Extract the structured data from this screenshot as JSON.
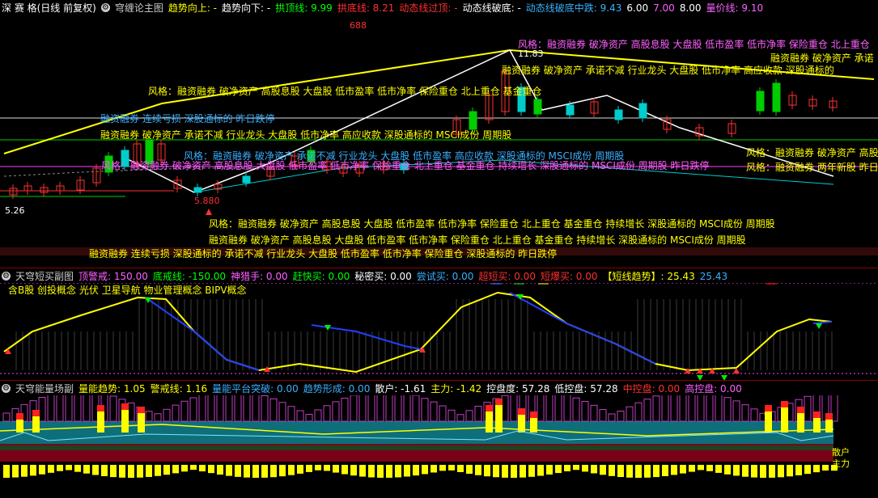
{
  "main": {
    "title": "深 赛 格(日线 前复权)",
    "indicator": "穹缠论主图",
    "items": [
      {
        "label": "趋势向上:",
        "value": "-",
        "color": "#ffff00"
      },
      {
        "label": "趋势向下:",
        "value": "-",
        "color": "#ffffff"
      },
      {
        "label": "拱顶线:",
        "value": "9.99",
        "color": "#00ff00"
      },
      {
        "label": "拱底线:",
        "value": "8.21",
        "color": "#ff3030"
      },
      {
        "label": "动态线过顶:",
        "value": "-",
        "color": "#ff3030"
      },
      {
        "label": "动态线破底:",
        "value": "-",
        "color": "#ffffff"
      },
      {
        "label": "动态线破底中跌:",
        "value": "9.43",
        "color": "#3ab0ff"
      },
      {
        "label": "",
        "value": "6.00",
        "color": "#ffffff"
      },
      {
        "label": "",
        "value": "7.00",
        "color": "#ff60ff"
      },
      {
        "label": "",
        "value": "8.00",
        "color": "#ffffff"
      },
      {
        "label": "量价线:",
        "value": "9.10",
        "color": "#ff60ff"
      }
    ],
    "price_labels": {
      "high": "688",
      "peak": "11.83",
      "low": "5.880",
      "left": "5.26"
    },
    "style_texts": [
      "风格：融资融券 破净资产 高股息股 大盘股 低市盈率 低市净率 保险重仓 北上重仓",
      "融资融券 破净资产 承诺不减 行业龙头 大盘股 低市净率 高应收款 深股通标的",
      "风格：融资融券 破净资产 高股息股 大盘股 低市盈率 低市净率 保险重仓 北上重仓 基金重仓",
      "融资融券 连续亏损 深股通标的 昨日跌停",
      "融资融券 破净资产 承诺不减 行业龙头 大盘股 低市净率 高应收款 深股通标的 MSCI成份 周期股",
      "风格：融资融券 破净资产 承诺不减 行业龙头 大盘股 低市盈率 高应收款 深股通标的 MSCI成份 周期股",
      "风格：融资融券 两年新股 昨日涨停",
      "风格：融资融券 破净资产 高股息股 大盘股 低市盈率 低市净率 保险重仓 北上重仓 基金重仓 持续增长 深股通标的 MSCI成份 周期股",
      "融资融券 破净资产 高股息股 大盘股 低市盈率 低市净率 保险重仓 北上重仓 基金重仓 持续增长 深股通标的 MSCI成份 周期股",
      "融资融券 连续亏损 深股通标的 承诺不减 行业龙头 大盘股 低市盈率 低市净率 保险重仓 深股通标的 昨日跌停",
      "风格：融资融券 破净资产 高股",
      "融资融券 破净资产 承诺",
      "风格：融资融券 破净资产 高股息股 大盘股 低市盈率 低市净率 保险重仓 北上重仓 基金重仓 持续增长 深股通标的 MSCI成份 周期股 昨日跌停"
    ],
    "flags": [
      "财",
      "跌",
      "榜",
      "涨"
    ]
  },
  "short": {
    "title": "天穹短买副图",
    "items": [
      {
        "label": "顶警戒:",
        "value": "150.00",
        "color": "#ff60ff"
      },
      {
        "label": "底戒线:",
        "value": "-150.00",
        "color": "#00ff00"
      },
      {
        "label": "神猎手:",
        "value": "0.00",
        "color": "#ff60ff"
      },
      {
        "label": "赶快买:",
        "value": "0.00",
        "color": "#00ff00"
      },
      {
        "label": "秘密买:",
        "value": "0.00",
        "color": "#ffffff"
      },
      {
        "label": "尝试买:",
        "value": "0.00",
        "color": "#3ab0ff"
      },
      {
        "label": "超短买:",
        "value": "0.00",
        "color": "#ff3030"
      },
      {
        "label": "短爆买:",
        "value": "0.00",
        "color": "#ff3030"
      },
      {
        "label": "【短线趋势】:",
        "value": "25.43",
        "color": "#ffff00"
      },
      {
        "label": "",
        "value": "25.43",
        "color": "#3ab0ff"
      }
    ],
    "concepts": "含B股 创投概念 光伏 卫星导航 物业管理概念 BIPV概念"
  },
  "volume": {
    "title": "天穹能量场副",
    "items": [
      {
        "label": "量能趋势:",
        "value": "1.05",
        "color": "#ffff00"
      },
      {
        "label": "警戒线:",
        "value": "1.16",
        "color": "#ffff00"
      },
      {
        "label": "量能平台突破:",
        "value": "0.00",
        "color": "#3ab0ff"
      },
      {
        "label": "趋势形成:",
        "value": "0.00",
        "color": "#3ab0ff"
      },
      {
        "label": "散户:",
        "value": "-1.61",
        "color": "#ffffff"
      },
      {
        "label": "主力:",
        "value": "-1.42",
        "color": "#ffff00"
      },
      {
        "label": "控盘度:",
        "value": "57.28",
        "color": "#ffffff"
      },
      {
        "label": "低控盘:",
        "value": "57.28",
        "color": "#ffffff"
      },
      {
        "label": "中控盘:",
        "value": "0.00",
        "color": "#ff3030"
      },
      {
        "label": "高控盘:",
        "value": "0.00",
        "color": "#ff60ff"
      }
    ],
    "right_labels": [
      "散户",
      "主力"
    ]
  }
}
